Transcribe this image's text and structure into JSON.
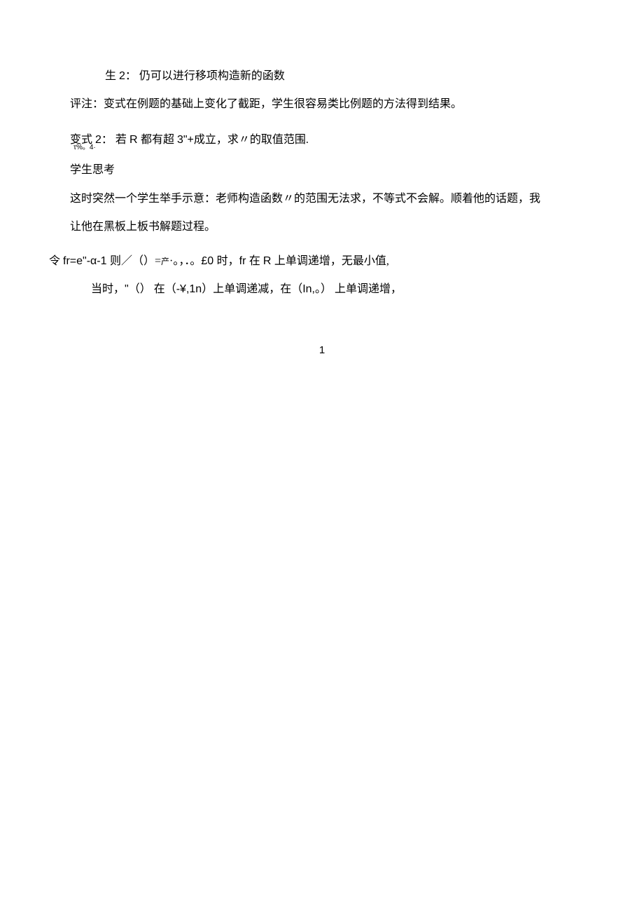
{
  "lines": {
    "l1_a": "生 ",
    "l1_b": "2",
    "l1_c": "： 仍可以进行移项构造新的函数",
    "l2": "评注：变式在例题的基础上变化了截距，学生很容易类比例题的方法得到结果。",
    "l3_a": "变式 ",
    "l3_b": "2",
    "l3_c": "： 若 ",
    "l3_d": "R ",
    "l3_e": "都有超 ",
    "l3_f": "3\"+",
    "l3_g": "成立，求〃的取值范围.",
    "l3_note": "τ%。4·",
    "l4": "学生思考",
    "l5": "这时突然一个学生举手示意：老师构造函数〃的范围无法求，不等式不会解。顺着他的话题，我",
    "l6": "让他在黑板上板书解题过程。",
    "l7_a": "令 ",
    "l7_b": "fr=e\"-α-1 ",
    "l7_c": "则／（）=",
    "l7_d": "产",
    "l7_e": "·。，．。",
    "l7_f": "£0 ",
    "l7_g": "时，",
    "l7_h": "fr ",
    "l7_i": "在 ",
    "l7_j": "R ",
    "l7_k": "上单调递增，无最小值,",
    "l8_a": "当时，",
    "l8_b": "\"",
    "l8_c": "（） 在（",
    "l8_d": "-¥,1n",
    "l8_e": "）上单调递减，在（",
    "l8_f": "In,",
    "l8_g": "。） 上单调递增，",
    "page_number": "1"
  }
}
